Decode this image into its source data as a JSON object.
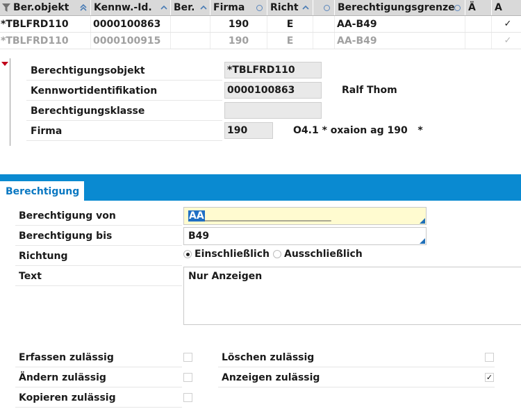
{
  "grid": {
    "filter_icon": "filter-icon",
    "columns": [
      {
        "label": "Ber.objekt",
        "icon": "double-chevron-up-icon"
      },
      {
        "label": "Kennw.-Id.",
        "icon": "chevron-up-icon"
      },
      {
        "label": "Ber.",
        "icon": "chevron-up-icon"
      },
      {
        "label": "Firma",
        "icon": "circle-icon"
      },
      {
        "label": "Richt",
        "icon": "chevron-up-icon"
      },
      {
        "label": "",
        "icon": "circle-icon"
      },
      {
        "label": "Berechtigungsgrenze",
        "icon": "circle-icon"
      },
      {
        "label": "",
        "icon": "circle-icon"
      },
      {
        "label": "Ä",
        "icon": ""
      },
      {
        "label": "A",
        "icon": ""
      }
    ],
    "rows": [
      {
        "objekt": "*TBLFRD110",
        "kennw": "0000100863",
        "ber": "",
        "firma": "190",
        "richt": "E",
        "grenze": "AA-B49",
        "ae": "",
        "a": "✓"
      },
      {
        "objekt": "*TBLFRD110",
        "kennw": "0000100915",
        "ber": "",
        "firma": "190",
        "richt": "E",
        "grenze": "AA-B49",
        "ae": "",
        "a": "✓"
      }
    ]
  },
  "detail": {
    "fields": [
      {
        "label": "Berechtigungsobjekt",
        "value": "*TBLFRD110",
        "extra": ""
      },
      {
        "label": "Kennwortidentifikation",
        "value": "0000100863",
        "extra": "Ralf Thom"
      },
      {
        "label": "Berechtigungsklasse",
        "value": "",
        "extra": ""
      },
      {
        "label": "Firma",
        "value": "190",
        "extra": "O4.1 * oxaion ag 190   *"
      }
    ]
  },
  "tab": {
    "label": "Berechtigung"
  },
  "form": {
    "von_label": "Berechtigung von",
    "von_selected": "AA",
    "von_rest": "__________________________",
    "bis_label": "Berechtigung bis",
    "bis_value": "B49",
    "richtung_label": "Richtung",
    "richtung_options": [
      "Einschließlich",
      "Ausschließlich"
    ],
    "richtung_selected": "Einschließlich",
    "text_label": "Text",
    "text_value": "Nur Anzeigen"
  },
  "permissions": [
    {
      "label": "Erfassen zulässig",
      "checked": false
    },
    {
      "label": "Ändern zulässig",
      "checked": false
    },
    {
      "label": "Kopieren zulässig",
      "checked": false
    },
    {
      "label": "Löschen zulässig",
      "checked": false
    },
    {
      "label": "Anzeigen zulässig",
      "checked": true
    }
  ],
  "colors": {
    "accent": "#0a8ad1",
    "header_bg": "#d9d9d9",
    "selection": "#1f6fc4",
    "input_highlight": "#fffbd0",
    "marker": "#c0001a"
  }
}
